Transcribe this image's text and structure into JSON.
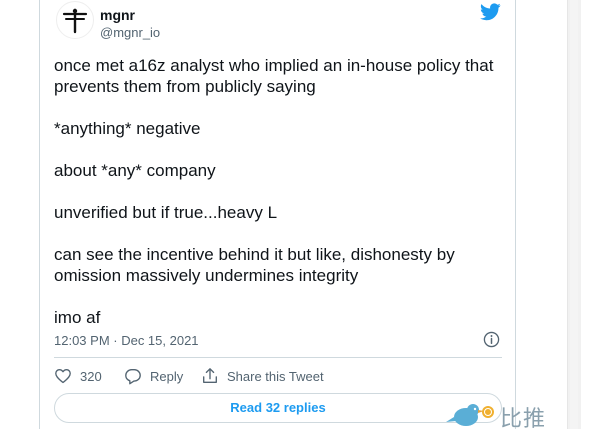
{
  "tweet": {
    "display_name": "mgnr",
    "handle": "@mgnr_io",
    "paragraphs": [
      "once met a16z analyst who implied an in-house policy that prevents them from publicly saying",
      "*anything* negative",
      "about *any* company",
      "unverified but if true...heavy L",
      "can see the incentive behind it but like, dishonesty by omission massively undermines integrity",
      "imo af"
    ],
    "timestamp": "12:03 PM · Dec 15, 2021"
  },
  "actions": {
    "like_count": "320",
    "reply_label": "Reply",
    "share_label": "Share this Tweet"
  },
  "read_replies_label": "Read 32 replies",
  "watermark": {
    "text": "比推",
    "icon": "bird-coin-logo"
  },
  "icons": {
    "brand": "twitter-bird-icon",
    "avatar": "dragonfly-icon",
    "info": "info-icon",
    "like": "heart-icon",
    "reply": "comment-icon",
    "share": "share-icon"
  },
  "colors": {
    "accent": "#1d9bf0",
    "text": "#0f1419",
    "secondary": "#536471",
    "border": "#cfd9de"
  }
}
